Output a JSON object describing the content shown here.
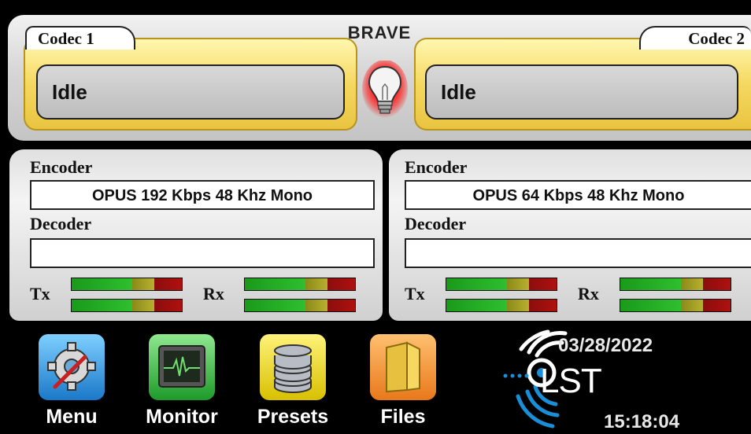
{
  "header": {
    "title": "BRAVE"
  },
  "codec1": {
    "tab_label": "Codec 1",
    "status": "Idle"
  },
  "codec2": {
    "tab_label": "Codec 2",
    "status": "Idle"
  },
  "panel_left": {
    "encoder_label": "Encoder",
    "encoder_value": "OPUS 192 Kbps 48 Khz Mono",
    "decoder_label": "Decoder",
    "decoder_value": "",
    "tx_label": "Tx",
    "rx_label": "Rx"
  },
  "panel_right": {
    "encoder_label": "Encoder",
    "encoder_value": "OPUS 64 Kbps 48 Khz Mono",
    "decoder_label": "Decoder",
    "decoder_value": "",
    "tx_label": "Tx",
    "rx_label": "Rx"
  },
  "toolbar": {
    "menu_label": "Menu",
    "monitor_label": "Monitor",
    "presets_label": "Presets",
    "files_label": "Files"
  },
  "status": {
    "date": "03/28/2022",
    "time": "15:18:04",
    "logo_text": "LST"
  },
  "colors": {
    "codec_yellow": "#f5d860",
    "meter_green": "#2fbf2f",
    "meter_yellow": "#b8b030",
    "meter_red": "#b01010",
    "bulb_glow": "#ff2020",
    "logo_blue": "#1a8fd8"
  },
  "icons": [
    "gear-icon",
    "monitor-icon",
    "database-icon",
    "folder-icon",
    "lightbulb-icon",
    "qlst-logo"
  ]
}
